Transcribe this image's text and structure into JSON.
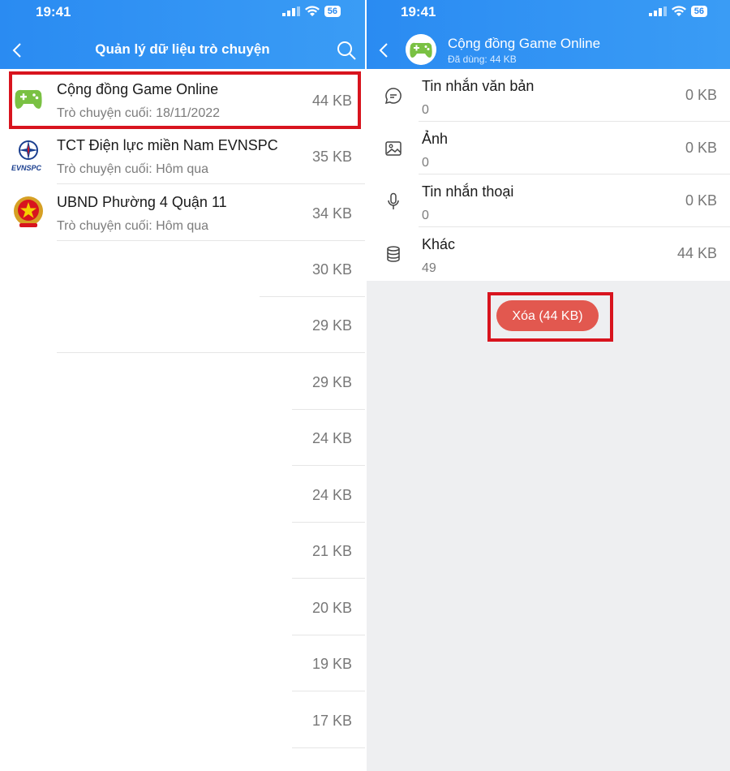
{
  "status": {
    "time": "19:41",
    "battery": "56"
  },
  "left": {
    "title": "Quản lý dữ liệu trò chuyện",
    "chats": [
      {
        "name": "Cộng đồng Game Online",
        "last": "Trò chuyện cuối: 18/11/2022",
        "size": "44 KB"
      },
      {
        "name": "TCT Điện lực miền Nam EVNSPC",
        "last": "Trò chuyện cuối: Hôm qua",
        "size": "35 KB",
        "logo_text": "EVNSPC"
      },
      {
        "name": "UBND Phường 4 Quận 11",
        "last": "Trò chuyện cuối: Hôm qua",
        "size": "34 KB"
      },
      {
        "size": "30 KB"
      },
      {
        "size": "29 KB"
      },
      {
        "size": "29 KB"
      },
      {
        "size": "24 KB"
      },
      {
        "size": "24 KB"
      },
      {
        "size": "21 KB"
      },
      {
        "size": "20 KB"
      },
      {
        "size": "19 KB"
      },
      {
        "size": "17 KB"
      }
    ]
  },
  "right": {
    "title": "Cộng đồng Game Online",
    "used": "Đã dùng: 44 KB",
    "categories": [
      {
        "name": "Tin nhắn văn bản",
        "count": "0",
        "size": "0 KB",
        "icon": "chat-bubble-icon"
      },
      {
        "name": "Ảnh",
        "count": "0",
        "size": "0 KB",
        "icon": "image-icon"
      },
      {
        "name": "Tin nhắn thoại",
        "count": "0",
        "size": "0 KB",
        "icon": "microphone-icon"
      },
      {
        "name": "Khác",
        "count": "49",
        "size": "44 KB",
        "icon": "database-icon"
      }
    ],
    "delete_label": "Xóa (44 KB)"
  },
  "colors": {
    "header": "#2a8bf2",
    "highlight": "#d8141e",
    "delete": "#e2584f"
  }
}
